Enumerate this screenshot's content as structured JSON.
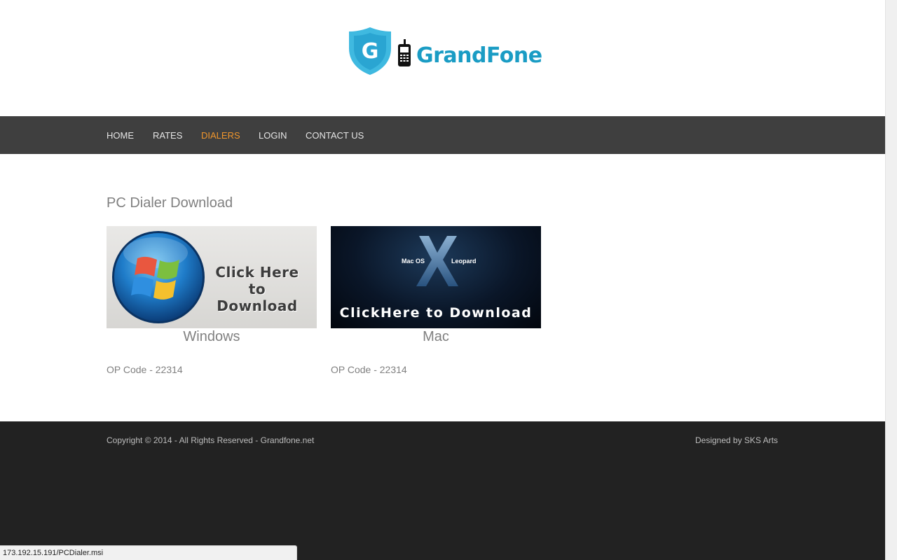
{
  "brand": {
    "name": "GrandFone",
    "shield_letter": "G",
    "color": "#1a9cc4"
  },
  "nav": {
    "items": [
      {
        "label": "HOME",
        "active": false
      },
      {
        "label": "RATES",
        "active": false
      },
      {
        "label": "DIALERS",
        "active": true
      },
      {
        "label": "LOGIN",
        "active": false
      },
      {
        "label": "CONTACT US",
        "active": false
      }
    ],
    "active_color": "#f0962c"
  },
  "main": {
    "title": "PC Dialer Download",
    "cards": [
      {
        "banner_text": "Click Here to Download",
        "caption": "Windows",
        "opcode": "OP Code - 22314",
        "icon": "windows-logo"
      },
      {
        "banner_text": "ClickHere to Download",
        "banner_left_label": "Mac OS",
        "banner_right_label": "Leopard",
        "caption": "Mac",
        "opcode": "OP Code - 22314",
        "icon": "mac-os-x-logo"
      }
    ]
  },
  "footer": {
    "copyright": "Copyright © 2014 - All Rights Reserved - Grandfone.net",
    "designer": "Designed by SKS Arts"
  },
  "status_bar": {
    "url": "173.192.15.191/PCDialer.msi"
  }
}
